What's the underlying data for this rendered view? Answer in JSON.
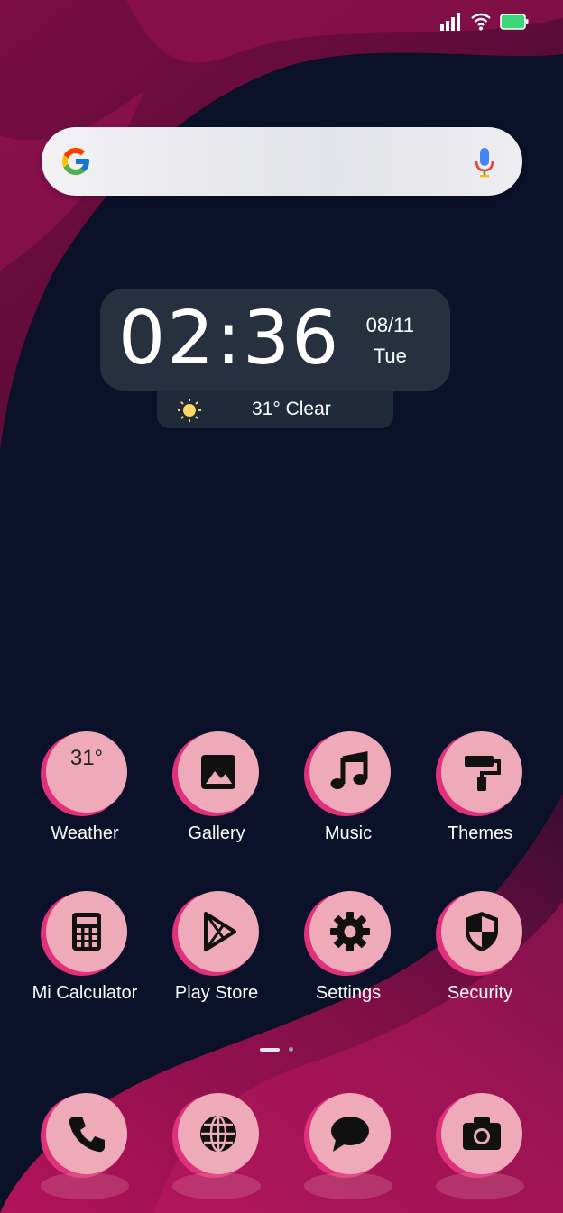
{
  "status_bar": {
    "signal_icon": "cellular-signal-icon",
    "wifi_icon": "wifi-icon",
    "battery_icon": "battery-icon",
    "battery_color": "#3bd67a"
  },
  "search": {
    "logo": "google-logo",
    "mic_icon": "microphone-icon"
  },
  "clock_widget": {
    "time": "02:36",
    "date": "08/11",
    "day": "Tue",
    "weather_icon": "sun-icon",
    "weather_text": "31° Clear"
  },
  "apps": [
    {
      "label": "Weather",
      "icon": "weather-icon",
      "icon_text": "31°"
    },
    {
      "label": "Gallery",
      "icon": "image-icon"
    },
    {
      "label": "Music",
      "icon": "music-note-icon"
    },
    {
      "label": "Themes",
      "icon": "paint-roller-icon"
    },
    {
      "label": "Mi Calculator",
      "icon": "calculator-icon"
    },
    {
      "label": "Play Store",
      "icon": "play-store-icon"
    },
    {
      "label": "Settings",
      "icon": "gear-icon"
    },
    {
      "label": "Security",
      "icon": "shield-icon"
    }
  ],
  "dock": [
    {
      "icon": "phone-icon"
    },
    {
      "icon": "globe-icon"
    },
    {
      "icon": "message-icon"
    },
    {
      "icon": "camera-icon"
    }
  ],
  "colors": {
    "icon_front": "#eeaab8",
    "icon_back": "#e0317a",
    "background": "#0b1228",
    "accent": "#b0145a"
  }
}
